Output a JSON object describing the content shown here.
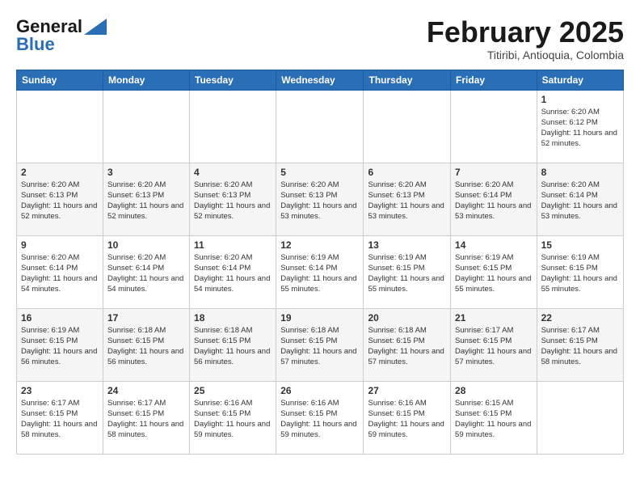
{
  "header": {
    "logo_general": "General",
    "logo_blue": "Blue",
    "month_title": "February 2025",
    "location": "Titiribi, Antioquia, Colombia"
  },
  "days_of_week": [
    "Sunday",
    "Monday",
    "Tuesday",
    "Wednesday",
    "Thursday",
    "Friday",
    "Saturday"
  ],
  "weeks": [
    [
      {
        "day": "",
        "info": ""
      },
      {
        "day": "",
        "info": ""
      },
      {
        "day": "",
        "info": ""
      },
      {
        "day": "",
        "info": ""
      },
      {
        "day": "",
        "info": ""
      },
      {
        "day": "",
        "info": ""
      },
      {
        "day": "1",
        "info": "Sunrise: 6:20 AM\nSunset: 6:12 PM\nDaylight: 11 hours and 52 minutes."
      }
    ],
    [
      {
        "day": "2",
        "info": "Sunrise: 6:20 AM\nSunset: 6:13 PM\nDaylight: 11 hours and 52 minutes."
      },
      {
        "day": "3",
        "info": "Sunrise: 6:20 AM\nSunset: 6:13 PM\nDaylight: 11 hours and 52 minutes."
      },
      {
        "day": "4",
        "info": "Sunrise: 6:20 AM\nSunset: 6:13 PM\nDaylight: 11 hours and 52 minutes."
      },
      {
        "day": "5",
        "info": "Sunrise: 6:20 AM\nSunset: 6:13 PM\nDaylight: 11 hours and 53 minutes."
      },
      {
        "day": "6",
        "info": "Sunrise: 6:20 AM\nSunset: 6:13 PM\nDaylight: 11 hours and 53 minutes."
      },
      {
        "day": "7",
        "info": "Sunrise: 6:20 AM\nSunset: 6:14 PM\nDaylight: 11 hours and 53 minutes."
      },
      {
        "day": "8",
        "info": "Sunrise: 6:20 AM\nSunset: 6:14 PM\nDaylight: 11 hours and 53 minutes."
      }
    ],
    [
      {
        "day": "9",
        "info": "Sunrise: 6:20 AM\nSunset: 6:14 PM\nDaylight: 11 hours and 54 minutes."
      },
      {
        "day": "10",
        "info": "Sunrise: 6:20 AM\nSunset: 6:14 PM\nDaylight: 11 hours and 54 minutes."
      },
      {
        "day": "11",
        "info": "Sunrise: 6:20 AM\nSunset: 6:14 PM\nDaylight: 11 hours and 54 minutes."
      },
      {
        "day": "12",
        "info": "Sunrise: 6:19 AM\nSunset: 6:14 PM\nDaylight: 11 hours and 55 minutes."
      },
      {
        "day": "13",
        "info": "Sunrise: 6:19 AM\nSunset: 6:15 PM\nDaylight: 11 hours and 55 minutes."
      },
      {
        "day": "14",
        "info": "Sunrise: 6:19 AM\nSunset: 6:15 PM\nDaylight: 11 hours and 55 minutes."
      },
      {
        "day": "15",
        "info": "Sunrise: 6:19 AM\nSunset: 6:15 PM\nDaylight: 11 hours and 55 minutes."
      }
    ],
    [
      {
        "day": "16",
        "info": "Sunrise: 6:19 AM\nSunset: 6:15 PM\nDaylight: 11 hours and 56 minutes."
      },
      {
        "day": "17",
        "info": "Sunrise: 6:18 AM\nSunset: 6:15 PM\nDaylight: 11 hours and 56 minutes."
      },
      {
        "day": "18",
        "info": "Sunrise: 6:18 AM\nSunset: 6:15 PM\nDaylight: 11 hours and 56 minutes."
      },
      {
        "day": "19",
        "info": "Sunrise: 6:18 AM\nSunset: 6:15 PM\nDaylight: 11 hours and 57 minutes."
      },
      {
        "day": "20",
        "info": "Sunrise: 6:18 AM\nSunset: 6:15 PM\nDaylight: 11 hours and 57 minutes."
      },
      {
        "day": "21",
        "info": "Sunrise: 6:17 AM\nSunset: 6:15 PM\nDaylight: 11 hours and 57 minutes."
      },
      {
        "day": "22",
        "info": "Sunrise: 6:17 AM\nSunset: 6:15 PM\nDaylight: 11 hours and 58 minutes."
      }
    ],
    [
      {
        "day": "23",
        "info": "Sunrise: 6:17 AM\nSunset: 6:15 PM\nDaylight: 11 hours and 58 minutes."
      },
      {
        "day": "24",
        "info": "Sunrise: 6:17 AM\nSunset: 6:15 PM\nDaylight: 11 hours and 58 minutes."
      },
      {
        "day": "25",
        "info": "Sunrise: 6:16 AM\nSunset: 6:15 PM\nDaylight: 11 hours and 59 minutes."
      },
      {
        "day": "26",
        "info": "Sunrise: 6:16 AM\nSunset: 6:15 PM\nDaylight: 11 hours and 59 minutes."
      },
      {
        "day": "27",
        "info": "Sunrise: 6:16 AM\nSunset: 6:15 PM\nDaylight: 11 hours and 59 minutes."
      },
      {
        "day": "28",
        "info": "Sunrise: 6:15 AM\nSunset: 6:15 PM\nDaylight: 11 hours and 59 minutes."
      },
      {
        "day": "",
        "info": ""
      }
    ]
  ]
}
